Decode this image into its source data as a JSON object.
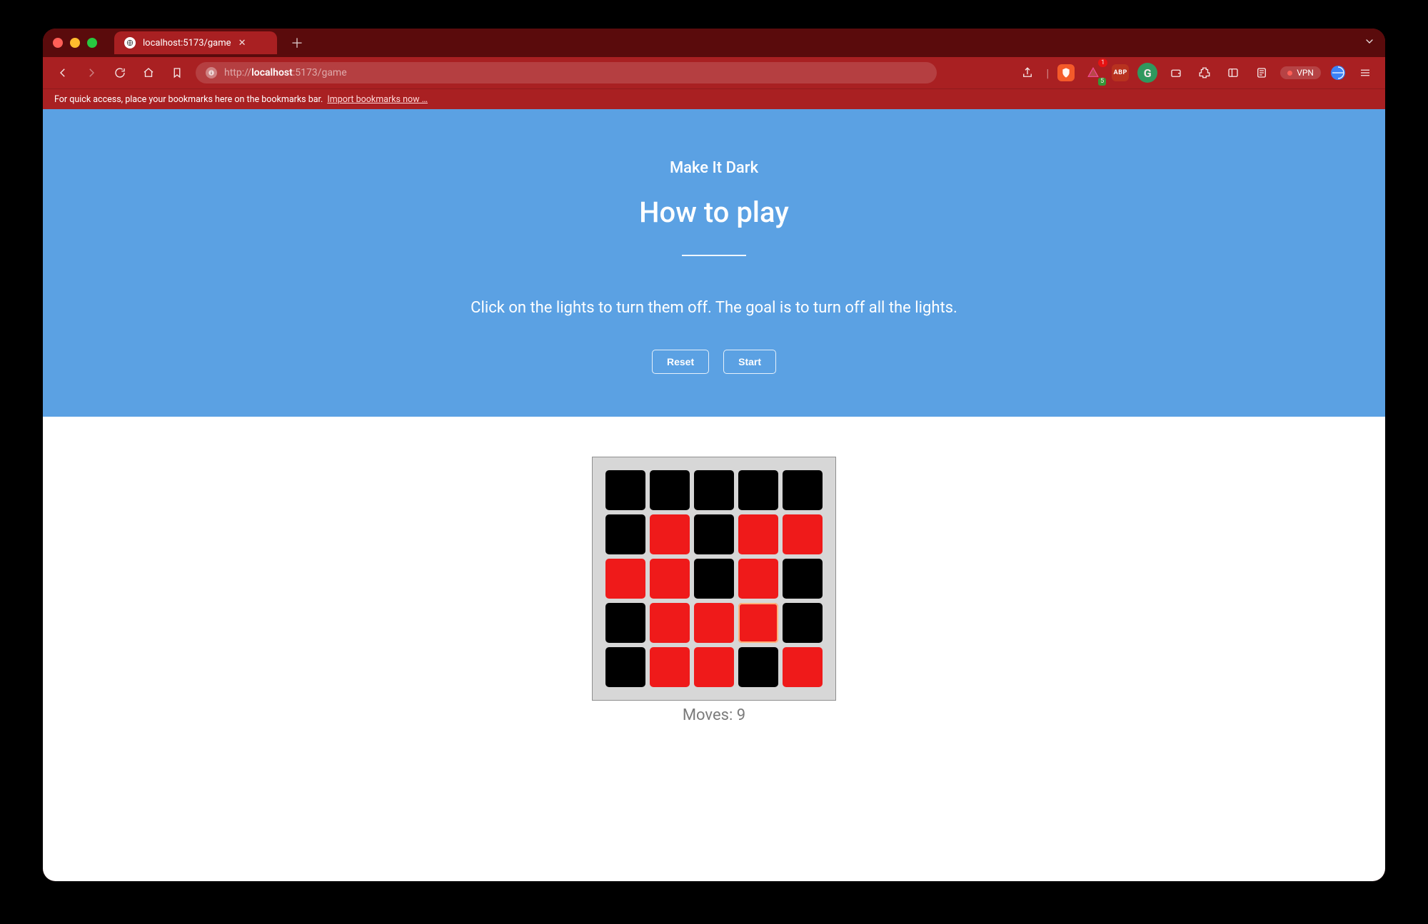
{
  "browser": {
    "tab_title": "localhost:5173/game",
    "url_scheme": "http://",
    "url_host": "localhost",
    "url_path": ":5173/game",
    "bookmarks_hint": "For quick access, place your bookmarks here on the bookmarks bar.",
    "import_link": "Import bookmarks now …",
    "vpn_label": "VPN",
    "rewards_badge": "1",
    "rewards_subbadge": "5"
  },
  "hero": {
    "brand": "Make It Dark",
    "heading": "How to play",
    "instructions": "Click on the lights to turn them off. The goal is to turn off all the lights.",
    "reset_label": "Reset",
    "start_label": "Start"
  },
  "game": {
    "moves_label": "Moves:",
    "moves": 9,
    "grid": [
      [
        0,
        0,
        0,
        0,
        0
      ],
      [
        0,
        1,
        0,
        1,
        1
      ],
      [
        1,
        1,
        0,
        1,
        0
      ],
      [
        0,
        1,
        1,
        1,
        0
      ],
      [
        0,
        1,
        1,
        0,
        1
      ]
    ],
    "last_move": [
      3,
      3
    ],
    "colors": {
      "on": "#ef1a1a",
      "off": "#000000",
      "board": "#d7d7d7",
      "hero": "#5ba1e3"
    }
  }
}
